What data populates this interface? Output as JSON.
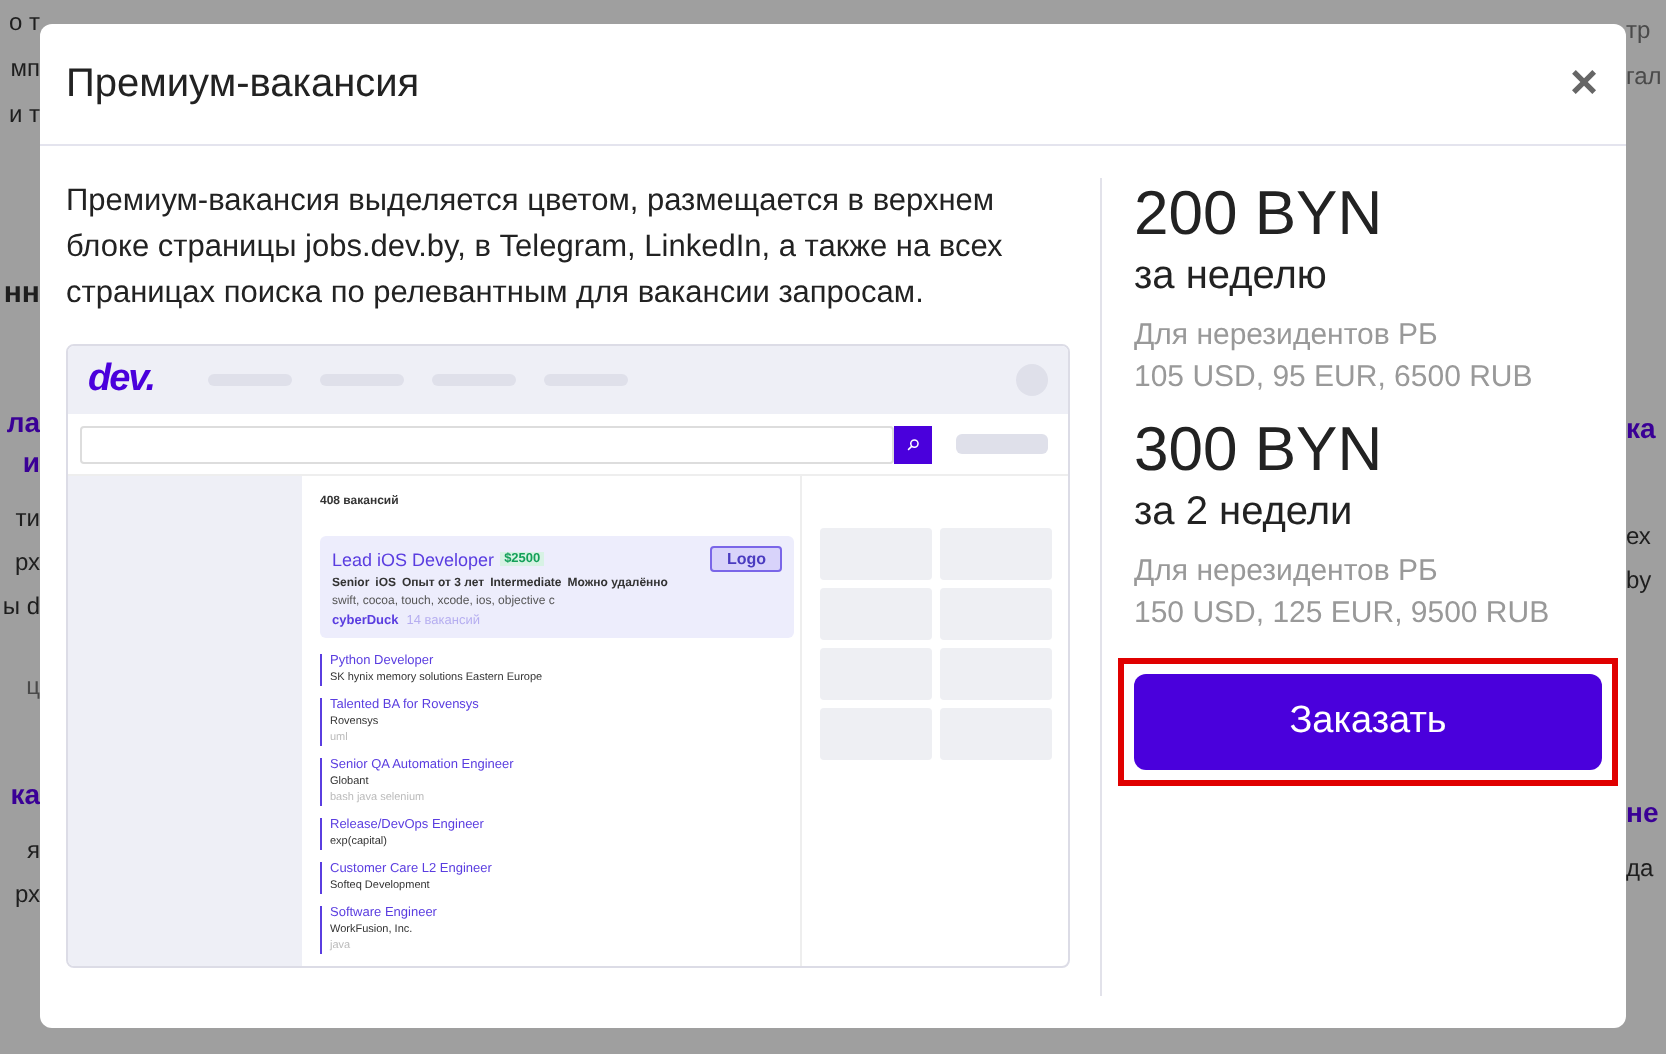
{
  "background": {
    "left": [
      {
        "text": "о т",
        "kind": "plain"
      },
      {
        "text": "мп",
        "kind": "plain"
      },
      {
        "text": "и т",
        "kind": "plain"
      },
      {
        "text": "нн",
        "kind": "heading"
      },
      {
        "text": "ла",
        "kind": "link"
      },
      {
        "text": "и",
        "kind": "link"
      },
      {
        "text": "ти",
        "kind": "plain"
      },
      {
        "text": "рх",
        "kind": "plain"
      },
      {
        "text": "ы d",
        "kind": "plain"
      },
      {
        "text": "ц",
        "kind": "muted"
      },
      {
        "text": "ка",
        "kind": "link"
      },
      {
        "text": "я",
        "kind": "plain"
      },
      {
        "text": "рх",
        "kind": "plain"
      }
    ],
    "right": [
      {
        "text": "тр",
        "kind": "muted"
      },
      {
        "text": "гал",
        "kind": "muted"
      },
      {
        "text": "ка",
        "kind": "link"
      },
      {
        "text": "ех",
        "kind": "plain"
      },
      {
        "text": "by",
        "kind": "plain"
      },
      {
        "text": "не",
        "kind": "link"
      },
      {
        "text": "да",
        "kind": "plain"
      }
    ]
  },
  "modal": {
    "title": "Премиум-вакансия",
    "close": "×",
    "description": "Премиум-вакансия выделяется цветом, размещается в верхнем блоке страницы jobs.dev.by, в Telegram, LinkedIn, а также на всех страницах поиска по релевантным для вакансии запросам.",
    "preview": {
      "logo": "dev.",
      "count": "408 вакансий",
      "featured": {
        "title": "Lead iOS Developer",
        "salary": "$2500",
        "logo": "Logo",
        "tags": [
          "Senior",
          "iOS",
          "Опыт от 3 лет",
          "Intermediate",
          "Можно удалённо"
        ],
        "skills": "swift, cocoa, touch, xcode, ios, objective c",
        "company": "cyberDuck",
        "company_jobs": "14 вакансий"
      },
      "jobs": [
        {
          "title": "Python Developer",
          "company": "SK hynix memory solutions Eastern Europe"
        },
        {
          "title": "Talented BA for Rovensys",
          "company": "Rovensys",
          "skills": "uml"
        },
        {
          "title": "Senior QA Automation Engineer",
          "company": "Globant",
          "skills": "bash java selenium"
        },
        {
          "title": "Release/DevOps Engineer",
          "company": "exp(capital)"
        },
        {
          "title": "Customer Care L2 Engineer",
          "company": "Softeq Development"
        },
        {
          "title": "Software Engineer",
          "company": "WorkFusion, Inc.",
          "skills": "java"
        }
      ]
    },
    "prices": [
      {
        "price": "200 BYN",
        "period": "за неделю",
        "note": "Для нерезидентов РБ",
        "foreign": "105 USD, 95 EUR, 6500 RUB"
      },
      {
        "price": "300 BYN",
        "period": "за 2 недели",
        "note": "Для нерезидентов РБ",
        "foreign": "150 USD, 125 EUR, 9500 RUB"
      }
    ],
    "order_button": {
      "label": "Заказать",
      "highlighted": true
    }
  }
}
